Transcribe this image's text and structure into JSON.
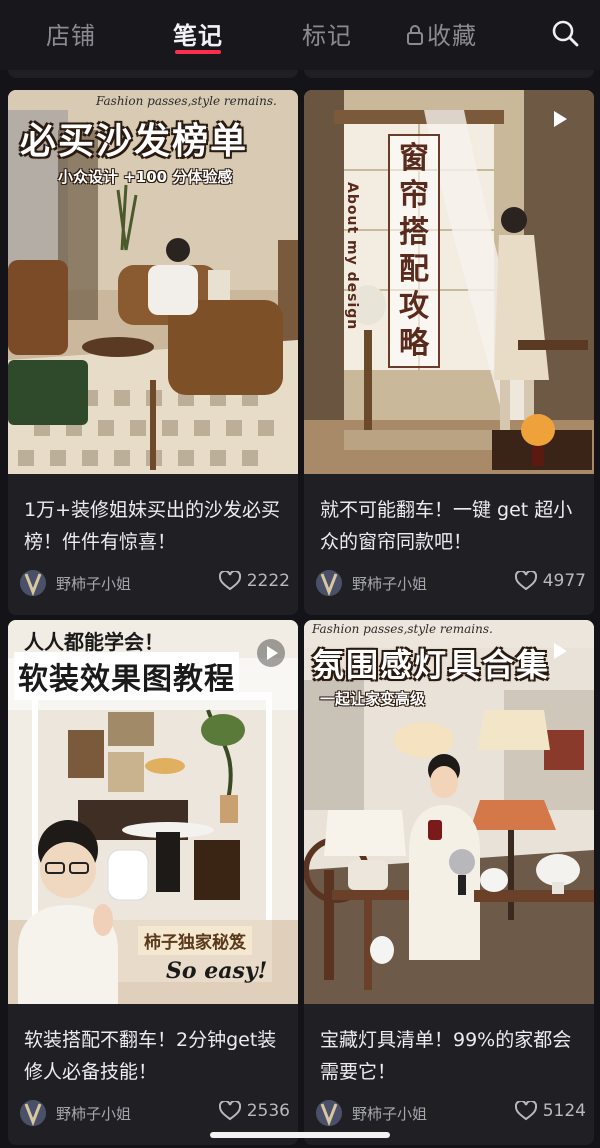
{
  "tabs": [
    {
      "label": "店铺",
      "active": false
    },
    {
      "label": "笔记",
      "active": true
    },
    {
      "label": "标记",
      "active": false
    },
    {
      "label": "收藏",
      "active": false,
      "icon": "lock-icon"
    }
  ],
  "search_icon": "search-icon",
  "accent_color": "#ff2e4d",
  "cards": [
    {
      "overlay_script": "Fashion passes,style remains.",
      "overlay_title": "必买沙发榜单",
      "overlay_subtitle": "小众设计 +100 分体验感",
      "title": "1万+装修姐妹买出的沙发必买榜！件件有惊喜！",
      "author": "野柿子小姐",
      "likes": "2222",
      "video": false
    },
    {
      "overlay_vertical": "窗帘搭配攻略",
      "overlay_en": "About my design",
      "title": "就不可能翻车！一键 get 超小众的窗帘同款吧！",
      "author": "野柿子小姐",
      "likes": "4977",
      "video": true
    },
    {
      "overlay_top": "人人都能学会！",
      "overlay_title": "软装效果图教程",
      "overlay_badge": "柿子独家秘笈",
      "overlay_en": "So easy!",
      "title": "软装搭配不翻车！2分钟get装修人必备技能！",
      "author": "野柿子小姐",
      "likes": "2536",
      "video": true
    },
    {
      "overlay_script": "Fashion passes,style remains.",
      "overlay_title": "氛围感灯具合集",
      "overlay_subtitle": "一起让家变高级",
      "title": "宝藏灯具清单！99%的家都会需要它！",
      "author": "野柿子小姐",
      "likes": "5124",
      "video": true
    }
  ]
}
